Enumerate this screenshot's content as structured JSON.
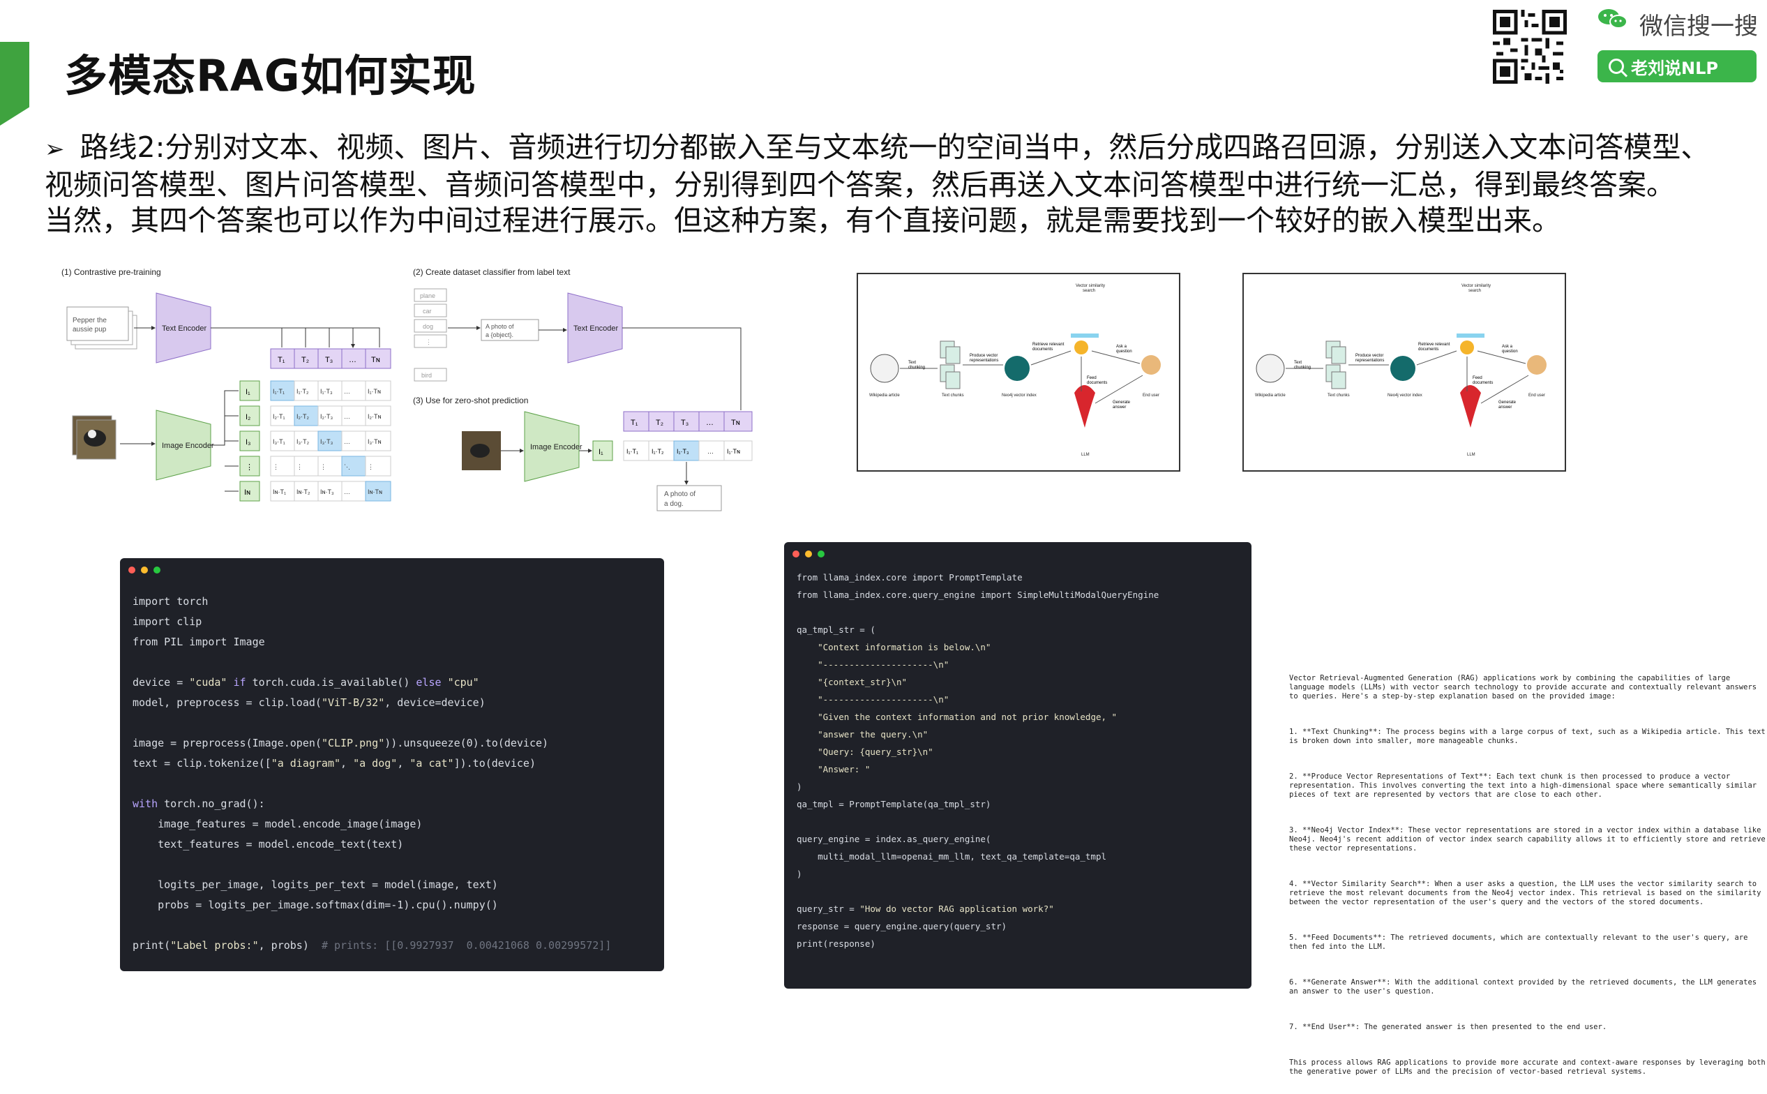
{
  "slide": {
    "title": "多模态RAG如何实现",
    "bullet_marker": "➢",
    "paragraph_lines": [
      "路线2:分别对文本、视频、图片、音频进行切分都嵌入至与文本统一的空间当中，然后分成四路召回源，分别送入文本问答模型、",
      "视频问答模型、图片问答模型、音频问答模型中，分别得到四个答案，然后再送入文本问答模型中进行统一汇总，得到最终答案。",
      "当然，其四个答案也可以作为中间过程进行展示。但这种方案，有个直接问题，就是需要找到一个较好的嵌入模型出来。"
    ]
  },
  "wechat": {
    "label": "微信搜一搜",
    "search_label": "老刘说NLP",
    "icon": "wechat-icon",
    "accent": "#3bb54a"
  },
  "clip_figure": {
    "heading1": "(1) Contrastive pre-training",
    "heading2": "(2) Create dataset classifier from label text",
    "heading3": "(3) Use for zero-shot prediction",
    "text_input": "Pepper the aussie pup",
    "text_encoder": "Text Encoder",
    "image_encoder": "Image Encoder",
    "labels": [
      "plane",
      "car",
      "dog",
      "bird"
    ],
    "template": "A photo of a {object}.",
    "result": "A photo of a dog.",
    "t_tokens": [
      "T1",
      "T2",
      "T3",
      "...",
      "TN"
    ],
    "i_tokens": [
      "I1",
      "I2",
      "I3",
      "...",
      "IN"
    ]
  },
  "rag_diagram": {
    "top_label": "Vector similarity search",
    "labels": [
      "Wikipedia article",
      "Text chunks",
      "Neo4j vector index",
      "End user",
      "LLM"
    ],
    "steps": [
      "Text chunking",
      "Produce vector representations of text",
      "Retrieve relevant documents",
      "Ask a question",
      "Feed documents",
      "Generate answer"
    ]
  },
  "code1": {
    "lines": [
      "import torch",
      "import clip",
      "from PIL import Image",
      "",
      "device = \"cuda\" if torch.cuda.is_available() else \"cpu\"",
      "model, preprocess = clip.load(\"ViT-B/32\", device=device)",
      "",
      "image = preprocess(Image.open(\"CLIP.png\")).unsqueeze(0).to(device)",
      "text = clip.tokenize([\"a diagram\", \"a dog\", \"a cat\"]).to(device)",
      "",
      "with torch.no_grad():",
      "    image_features = model.encode_image(image)",
      "    text_features = model.encode_text(text)",
      "",
      "    logits_per_image, logits_per_text = model(image, text)",
      "    probs = logits_per_image.softmax(dim=-1).cpu().numpy()",
      "",
      "print(\"Label probs:\", probs)  # prints: [[0.9927937  0.00421068 0.00299572]]"
    ]
  },
  "code2": {
    "lines": [
      "from llama_index.core import PromptTemplate",
      "from llama_index.core.query_engine import SimpleMultiModalQueryEngine",
      "",
      "qa_tmpl_str = (",
      "    \"Context information is below.\\n\"",
      "    \"---------------------\\n\"",
      "    \"{context_str}\\n\"",
      "    \"---------------------\\n\"",
      "    \"Given the context information and not prior knowledge, \"",
      "    \"answer the query.\\n\"",
      "    \"Query: {query_str}\\n\"",
      "    \"Answer: \"",
      ")",
      "qa_tmpl = PromptTemplate(qa_tmpl_str)",
      "",
      "query_engine = index.as_query_engine(",
      "    multi_modal_llm=openai_mm_llm, text_qa_template=qa_tmpl",
      ")",
      "",
      "query_str = \"How do vector RAG application work?\"",
      "response = query_engine.query(query_str)",
      "print(response)"
    ]
  },
  "explanation": {
    "paragraphs": [
      "Vector Retrieval-Augmented Generation (RAG) applications work by combining the capabilities of large language models (LLMs) with vector search technology to provide accurate and contextually relevant answers to queries. Here's a step-by-step explanation based on the provided image:",
      "1. **Text Chunking**: The process begins with a large corpus of text, such as a Wikipedia article. This text is broken down into smaller, more manageable chunks.",
      "2. **Produce Vector Representations of Text**: Each text chunk is then processed to produce a vector representation. This involves converting the text into a high-dimensional space where semantically similar pieces of text are represented by vectors that are close to each other.",
      "3. **Neo4j Vector Index**: These vector representations are stored in a vector index within a database like Neo4j. Neo4j's recent addition of vector index search capability allows it to efficiently store and retrieve these vector representations.",
      "4. **Vector Similarity Search**: When a user asks a question, the LLM uses the vector similarity search to retrieve the most relevant documents from the Neo4j vector index. This retrieval is based on the similarity between the vector representation of the user's query and the vectors of the stored documents.",
      "5. **Feed Documents**: The retrieved documents, which are contextually relevant to the user's query, are then fed into the LLM.",
      "6. **Generate Answer**: With the additional context provided by the retrieved documents, the LLM generates an answer to the user's question.",
      "7. **End User**: The generated answer is then presented to the end user.",
      "This process allows RAG applications to provide more accurate and context-aware responses by leveraging both the generative power of LLMs and the precision of vector-based retrieval systems."
    ]
  }
}
